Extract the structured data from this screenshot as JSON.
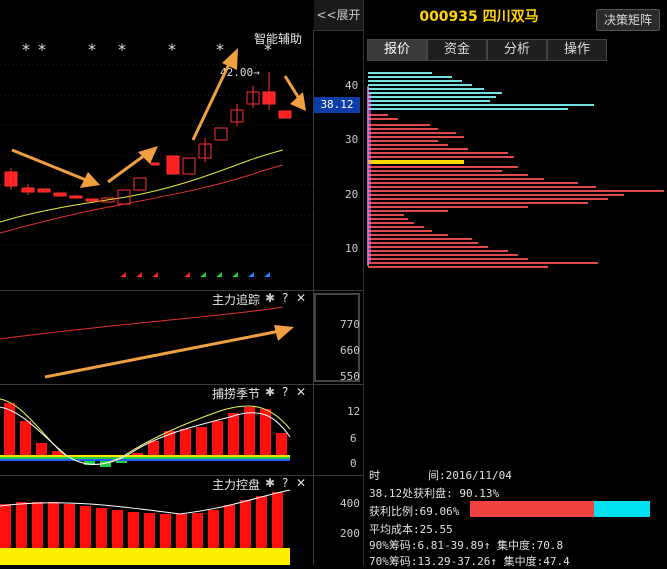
{
  "left_panel": {
    "expand_label": "<<展开",
    "main_title": "智能辅助",
    "peak_label": "42.00→",
    "price_tag": "38.12",
    "price_axis": [
      "40",
      "30",
      "20",
      "10"
    ],
    "star_glyph": "*",
    "pane2": {
      "title": "主力追踪",
      "axis": [
        "770",
        "660",
        "550"
      ]
    },
    "pane3": {
      "title": "捕捞季节",
      "axis": [
        "12",
        "6",
        "0"
      ]
    },
    "pane4": {
      "title": "主力控盘",
      "axis": [
        "400",
        "200"
      ]
    },
    "gear_glyph": "✱",
    "help_glyph": "?",
    "close_glyph": "✕"
  },
  "right_panel": {
    "stock_title": "000935 四川双马",
    "decide_button": "决策矩阵",
    "tabs": [
      "报价",
      "资金",
      "分析",
      "操作"
    ],
    "active_tab": 0,
    "info": {
      "time_label": "时",
      "time_value": "间:2016/11/04",
      "profit_line": "38.12处获利盘: 90.13%",
      "profit_ratio_label": "获利比例:69.06%",
      "avg_cost": "平均成本:25.55",
      "chip90": "90%筹码:6.81-39.89↑ 集中度:70.8",
      "chip70": "70%筹码:13.29-37.26↑ 集中度:47.4"
    },
    "profit_ratio": 0.6906,
    "colors": {
      "profit": "#f04040",
      "loss": "#00e0f0"
    }
  }
}
